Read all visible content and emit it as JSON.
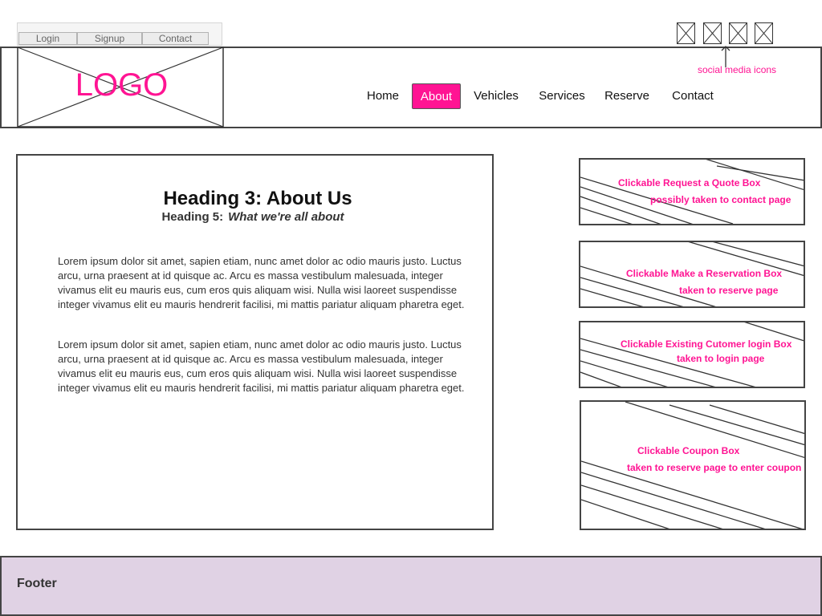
{
  "utility": {
    "login": "Login",
    "signup": "Signup",
    "contact": "Contact"
  },
  "social": {
    "icons": [
      "social-icon-1",
      "social-icon-2",
      "social-icon-3",
      "social-icon-4"
    ],
    "note": "social media icons"
  },
  "header": {
    "logo": "LOGO",
    "nav": [
      {
        "label": "Home",
        "active": false
      },
      {
        "label": "About",
        "active": true
      },
      {
        "label": "Vehicles",
        "active": false
      },
      {
        "label": "Services",
        "active": false
      },
      {
        "label": "Reserve",
        "active": false
      },
      {
        "label": "Contact",
        "active": false
      }
    ]
  },
  "main": {
    "heading3": "Heading 3: About Us",
    "heading5_prefix": "Heading 5:",
    "heading5_sub": "What we're all about",
    "paragraphs": [
      "Lorem ipsum dolor sit amet, sapien etiam, nunc amet dolor ac odio mauris justo. Luctus arcu, urna praesent at id quisque ac. Arcu es massa vestibulum malesuada, integer vivamus elit eu mauris eus, cum eros quis aliquam wisi. Nulla wisi laoreet suspendisse integer vivamus elit eu mauris hendrerit facilisi, mi mattis pariatur aliquam pharetra eget.",
      "Lorem ipsum dolor sit amet, sapien etiam, nunc amet dolor ac odio mauris justo. Luctus arcu, urna praesent at id quisque ac. Arcu es massa vestibulum malesuada, integer vivamus elit eu mauris eus, cum eros quis aliquam wisi. Nulla wisi laoreet suspendisse integer vivamus elit eu mauris hendrerit facilisi, mi mattis pariatur aliquam pharetra eget."
    ]
  },
  "sidebar": {
    "quote": {
      "title": "Clickable Request a Quote Box",
      "note": "possibly taken to contact page"
    },
    "reservation": {
      "title": "Clickable Make a Reservation Box",
      "note": "taken to reserve page"
    },
    "login": {
      "title": "Clickable Existing Cutomer login Box",
      "note": "taken to login page"
    },
    "coupon": {
      "title": "Clickable Coupon Box",
      "note": "taken to reserve page to enter coupon"
    }
  },
  "footer": {
    "text": "Footer"
  },
  "colors": {
    "accent": "#ff1493",
    "footer_bg": "#e0d2e4",
    "border": "#444444"
  }
}
